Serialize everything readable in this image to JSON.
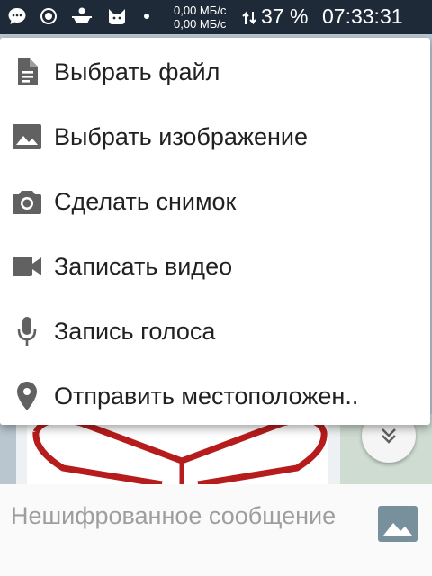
{
  "status_bar": {
    "speed_up": "0,00 МБ/с",
    "speed_down": "0,00 МБ/с",
    "battery": "37 %",
    "time": "07:33:31",
    "icons": [
      "message-icon",
      "record-icon",
      "tray-icon",
      "cat-icon",
      "notification-dot",
      "wifi-icon",
      "data-arrows-icon"
    ]
  },
  "attach_menu": {
    "items": [
      {
        "label": "Выбрать файл",
        "icon": "file-icon"
      },
      {
        "label": "Выбрать изображение",
        "icon": "image-icon"
      },
      {
        "label": "Сделать снимок",
        "icon": "camera-icon"
      },
      {
        "label": "Записать видео",
        "icon": "videocam-icon"
      },
      {
        "label": "Запись голоса",
        "icon": "mic-icon"
      },
      {
        "label": "Отправить местоположен..",
        "icon": "location-icon"
      }
    ]
  },
  "compose": {
    "placeholder": "Нешифрованное сообщение",
    "attach_icon": "gallery-icon"
  },
  "colors": {
    "status_bar_bg": "#1f2a38",
    "menu_icon": "#616161",
    "menu_text": "#212121",
    "placeholder": "#9e9e9e",
    "gallery_icon": "#78909c"
  }
}
